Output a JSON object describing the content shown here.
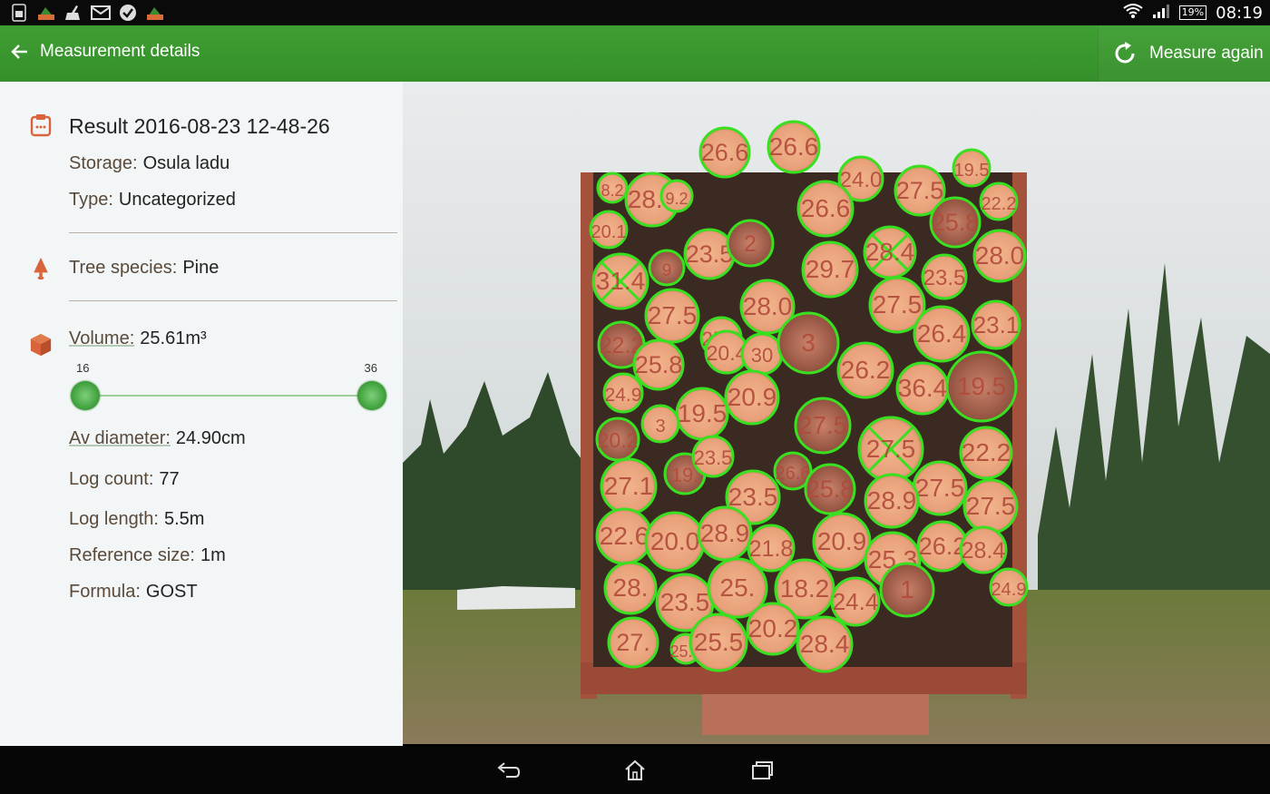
{
  "status_bar": {
    "notification_icons": [
      "sim-card-icon",
      "log-app-icon",
      "broom-icon",
      "mail-icon",
      "check-circle-icon",
      "log-app-icon"
    ],
    "battery": "19%",
    "time": "08:19"
  },
  "app_bar": {
    "title": "Measurement details",
    "action_label": "Measure again",
    "background": "#3a9a2e"
  },
  "details": {
    "result_title": "Result 2016-08-23 12-48-26",
    "storage_label": "Storage:",
    "storage_value": "Osula ladu",
    "type_label": "Type:",
    "type_value": "Uncategorized",
    "species_label": "Tree species:",
    "species_value": "Pine",
    "volume_label": "Volume:",
    "volume_value": "25.61m³",
    "slider_min": "16",
    "slider_max": "36",
    "av_diameter_label": "Av diameter:",
    "av_diameter_value": "24.90cm",
    "log_count_label": "Log count:",
    "log_count_value": "77",
    "log_length_label": "Log length:",
    "log_length_value": "5.5m",
    "reference_label": "Reference size:",
    "reference_value": "1m",
    "formula_label": "Formula:",
    "formula_value": "GOST",
    "icon_color": "#d9633a"
  },
  "photo": {
    "circle_color": "#39e020",
    "label_color": "#b04a3a",
    "logs": [
      {
        "label": "26.6"
      },
      {
        "label": "26.6"
      },
      {
        "label": "24.0"
      },
      {
        "label": "27.5"
      },
      {
        "label": "19.5"
      },
      {
        "label": "8.2"
      },
      {
        "label": "28.9"
      },
      {
        "label": "9.2"
      },
      {
        "label": "26.6"
      },
      {
        "label": "25.8"
      },
      {
        "label": "22.2"
      },
      {
        "label": "20.1"
      },
      {
        "label": "23.5"
      },
      {
        "label": "2"
      },
      {
        "label": "29.7"
      },
      {
        "label": "28.4"
      },
      {
        "label": "23.5"
      },
      {
        "label": "28.0"
      },
      {
        "label": "31.4"
      },
      {
        "label": "9"
      },
      {
        "label": "27.5"
      },
      {
        "label": "25.8"
      },
      {
        "label": "28.0"
      },
      {
        "label": "27.5"
      },
      {
        "label": "26.4"
      },
      {
        "label": "23.1"
      },
      {
        "label": "22.2"
      },
      {
        "label": "25.8"
      },
      {
        "label": "20.4"
      },
      {
        "label": "30"
      },
      {
        "label": "3"
      },
      {
        "label": "26.2"
      },
      {
        "label": "36.4"
      },
      {
        "label": "19.5"
      },
      {
        "label": "24.9"
      },
      {
        "label": "20.9"
      },
      {
        "label": "19.5"
      },
      {
        "label": "20.2"
      },
      {
        "label": "3"
      },
      {
        "label": "27.5"
      },
      {
        "label": "27.5"
      },
      {
        "label": "22.2"
      },
      {
        "label": "27.1"
      },
      {
        "label": "19."
      },
      {
        "label": "23.5"
      },
      {
        "label": "23.5"
      },
      {
        "label": "26.6"
      },
      {
        "label": "27.5"
      },
      {
        "label": "25.8"
      },
      {
        "label": "27.5"
      },
      {
        "label": "28.9"
      },
      {
        "label": "22.6"
      },
      {
        "label": "20.0"
      },
      {
        "label": "28.9"
      },
      {
        "label": "21.8"
      },
      {
        "label": "20.9"
      },
      {
        "label": "25.3"
      },
      {
        "label": "26.2"
      },
      {
        "label": "28.4"
      },
      {
        "label": "28."
      },
      {
        "label": "23.5"
      },
      {
        "label": "25."
      },
      {
        "label": "18.2"
      },
      {
        "label": "24.4"
      },
      {
        "label": "1"
      },
      {
        "label": "24.9"
      },
      {
        "label": "27."
      },
      {
        "label": "25.8"
      },
      {
        "label": "25.5"
      },
      {
        "label": "20.2"
      },
      {
        "label": "28.4"
      }
    ]
  },
  "nav_bar": {
    "back": "back-icon",
    "home": "home-icon",
    "recents": "recents-icon"
  }
}
